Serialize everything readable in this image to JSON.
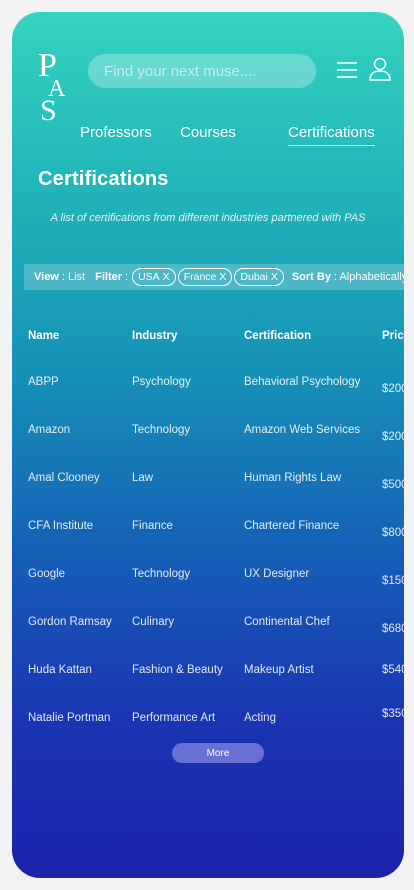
{
  "header": {
    "logo_letters": [
      "P",
      "A",
      "S"
    ],
    "search": {
      "placeholder": "Find your next muse...."
    },
    "icons": [
      "menu-icon",
      "user-icon"
    ]
  },
  "nav": {
    "tabs": [
      {
        "label": "Professors",
        "active": false
      },
      {
        "label": "Courses",
        "active": false
      },
      {
        "label": "Certifications",
        "active": true
      }
    ]
  },
  "page": {
    "title": "Certifications",
    "subtitle": "A list of certifications from different industries partnered with PAS"
  },
  "filter_bar": {
    "view_label": "View",
    "view_value": ": List",
    "filter_label": "Filter",
    "filter_colon": ":",
    "chips": [
      {
        "label": "USA",
        "remove": "X"
      },
      {
        "label": "France",
        "remove": "X"
      },
      {
        "label": "Dubai",
        "remove": "X"
      }
    ],
    "sort_label": "Sort By",
    "sort_value": ": Alphabetically"
  },
  "table": {
    "headers": {
      "name": "Name",
      "industry": "Industry",
      "certification": "Certification",
      "price": "Price"
    },
    "rows": [
      {
        "name": "ABPP",
        "industry": "Psychology",
        "certification": "Behavioral Psychology",
        "price": "$200"
      },
      {
        "name": "Amazon",
        "industry": "Technology",
        "certification": "Amazon Web Services",
        "price": "$200"
      },
      {
        "name": "Amal Clooney",
        "industry": "Law",
        "certification": "Human Rights Law",
        "price": "$500"
      },
      {
        "name": "CFA Institute",
        "industry": "Finance",
        "certification": "Chartered Finance",
        "price": "$800"
      },
      {
        "name": "Google",
        "industry": "Technology",
        "certification": "UX Designer",
        "price": "$150"
      },
      {
        "name": "Gordon Ramsay",
        "industry": "Culinary",
        "certification": "Continental Chef",
        "price": "$680"
      },
      {
        "name": "Huda Kattan",
        "industry": "Fashion & Beauty",
        "certification": "Makeup Artist",
        "price": "$540"
      },
      {
        "name": "Natalie Portman",
        "industry": "Performance Art",
        "certification": "Acting",
        "price": "$350"
      }
    ]
  },
  "more_button": {
    "label": "More"
  },
  "colors": {
    "gradient_top": "#34d4c0",
    "gradient_mid": "#1690b6",
    "gradient_bottom": "#1c22ab",
    "text": "#ffffff"
  }
}
